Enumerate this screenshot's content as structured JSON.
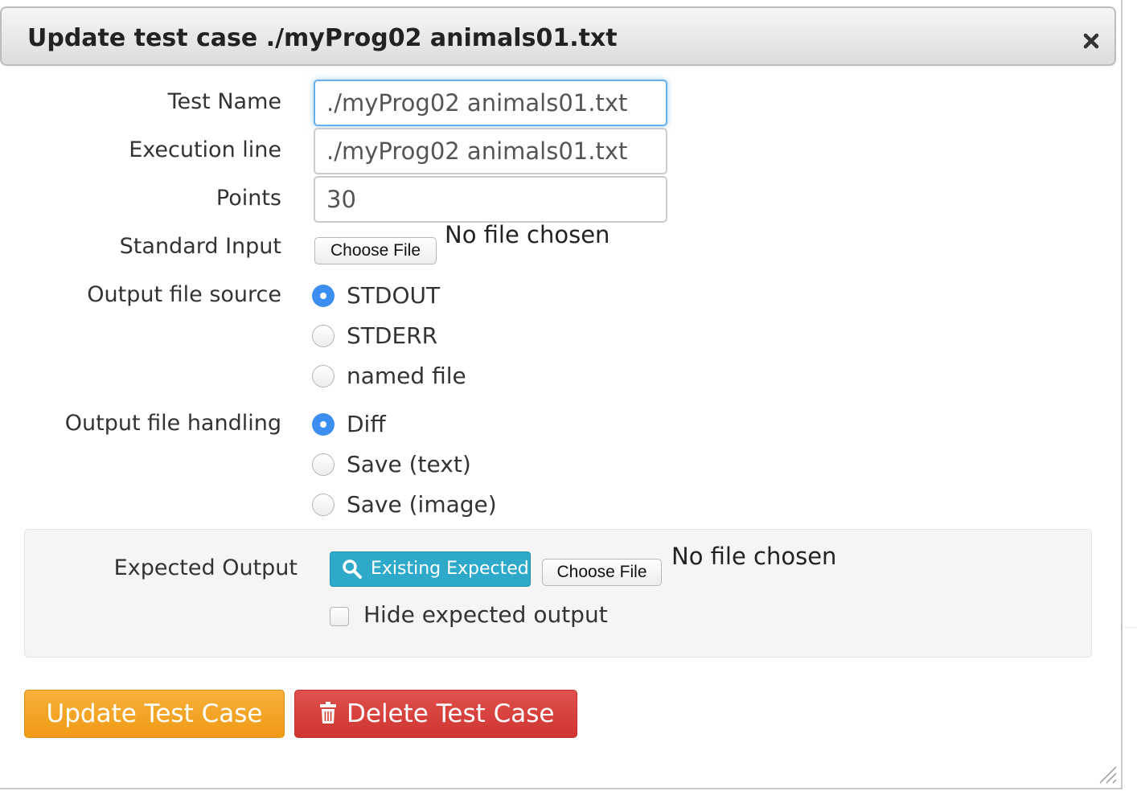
{
  "dialog": {
    "title": "Update test case ./myProg02 animals01.txt",
    "close_icon": "close-icon"
  },
  "form": {
    "test_name": {
      "label": "Test Name",
      "value": "./myProg02 animals01.txt"
    },
    "execution_line": {
      "label": "Execution line",
      "value": "./myProg02 animals01.txt"
    },
    "points": {
      "label": "Points",
      "value": "30"
    },
    "standard_input": {
      "label": "Standard Input",
      "button": "Choose File",
      "status": "No file chosen"
    },
    "output_source": {
      "label": "Output file source",
      "options": [
        {
          "label": "STDOUT",
          "checked": true
        },
        {
          "label": "STDERR",
          "checked": false
        },
        {
          "label": "named file",
          "checked": false
        }
      ]
    },
    "output_handling": {
      "label": "Output file handling",
      "options": [
        {
          "label": "Diff",
          "checked": true
        },
        {
          "label": "Save (text)",
          "checked": false
        },
        {
          "label": "Save (image)",
          "checked": false
        }
      ]
    },
    "expected_output": {
      "label": "Expected Output",
      "existing_button": "Existing Expected",
      "existing_icon": "search-icon",
      "file_button": "Choose File",
      "status": "No file chosen",
      "hide_label": "Hide expected output",
      "hide_checked": false
    }
  },
  "actions": {
    "update": "Update Test Case",
    "delete": "Delete Test Case",
    "delete_icon": "trash-icon"
  },
  "colors": {
    "focus": "#66afe9",
    "radio_checked": "#3d8fef",
    "info": "#2fa9c9",
    "warning": "#f0a020",
    "danger": "#d9413d"
  }
}
